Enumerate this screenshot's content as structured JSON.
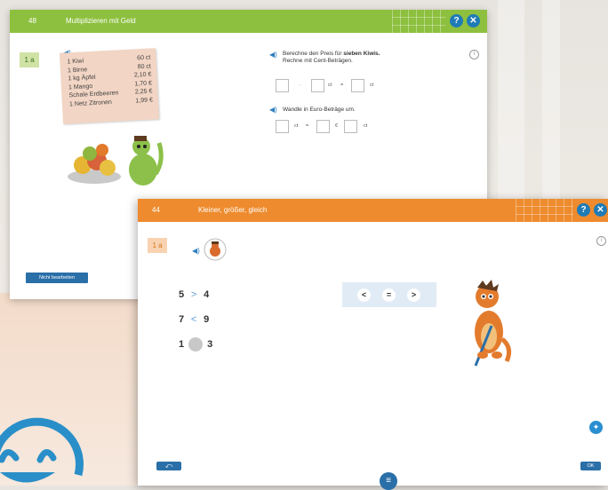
{
  "window1": {
    "number": "48",
    "title": "Multiplizieren mit Geld",
    "badge": "1 a",
    "price_list": [
      {
        "item": "1 Kiwi",
        "price": "60 ct"
      },
      {
        "item": "1 Birne",
        "price": "80 ct"
      },
      {
        "item": "1 kg Äpfel",
        "price": "2,10 €"
      },
      {
        "item": "1 Mango",
        "price": "1,70 €"
      },
      {
        "item": "Schale Erdbeeren",
        "price": "2,25 €"
      },
      {
        "item": "1 Netz Zitronen",
        "price": "1,99 €"
      }
    ],
    "task1_prefix": "Berechne den Preis für",
    "task1_bold": "sieben Kiwis.",
    "task1_line2": "Rechne mit Cent-Beträgen.",
    "op_mult": "·",
    "op_eq": "=",
    "unit_ct": "ct",
    "unit_euro": "€",
    "task2": "Wandle in Euro-Beträge um.",
    "skip_button": "Nicht bearbeiten",
    "help_icon": "?",
    "close_icon": "✕",
    "info_icon": "i"
  },
  "window2": {
    "number": "44",
    "title": "Kleiner, größer, gleich",
    "badge": "1 a",
    "rows": [
      {
        "left": "5",
        "op": ">",
        "right": "4"
      },
      {
        "left": "7",
        "op": "<",
        "right": "9"
      },
      {
        "left": "1",
        "op": "",
        "right": "3"
      }
    ],
    "choices": [
      "<",
      "=",
      ">"
    ],
    "ok_button": "OK",
    "help_icon": "?",
    "close_icon": "✕",
    "info_icon": "i",
    "undo_icon": "⤺",
    "menu_icon": "≡",
    "hint_icon": "✦"
  },
  "colors": {
    "green_title": "#8dc03f",
    "orange_title": "#ee8b2e",
    "blue_button": "#2a6fa8",
    "logo_blue": "#2a8fc8"
  }
}
